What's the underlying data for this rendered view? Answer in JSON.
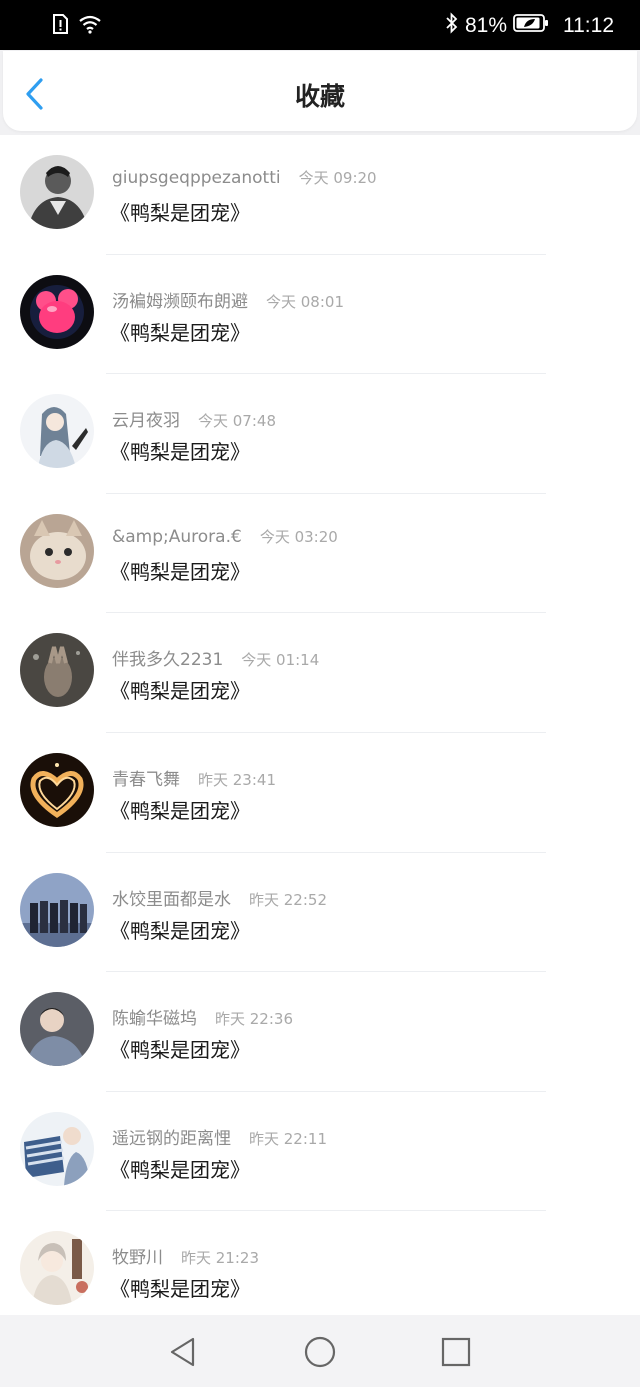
{
  "status_bar": {
    "battery": "81%",
    "time": "11:12",
    "icons": [
      "sim-alert-icon",
      "wifi-icon",
      "bluetooth-icon",
      "battery-icon"
    ]
  },
  "header": {
    "title": "收藏",
    "back_icon": "chevron-left-icon"
  },
  "favorites": [
    {
      "user": "giupsgeqppezanotti",
      "time": "今天 09:20",
      "title": "《鸭梨是团宠》",
      "avatar_color": "#7a7a7a"
    },
    {
      "user": "汤褊姆濒颐布朗避",
      "time": "今天 08:01",
      "title": "《鸭梨是团宠》",
      "avatar_color": "#e2437a"
    },
    {
      "user": "云月夜羽",
      "time": "今天 07:48",
      "title": "《鸭梨是团宠》",
      "avatar_color": "#dfe6ee"
    },
    {
      "user": "&amp;Aurora.€",
      "time": "今天 03:20",
      "title": "《鸭梨是团宠》",
      "avatar_color": "#c9a98d"
    },
    {
      "user": "伴我多久2231",
      "time": "今天 01:14",
      "title": "《鸭梨是团宠》",
      "avatar_color": "#3d3b36"
    },
    {
      "user": "青春飞舞",
      "time": "昨天 23:41",
      "title": "《鸭梨是团宠》",
      "avatar_color": "#2a1a10"
    },
    {
      "user": "水饺里面都是水",
      "time": "昨天 22:52",
      "title": "《鸭梨是团宠》",
      "avatar_color": "#7f93b8"
    },
    {
      "user": "陈蝓华磁坞",
      "time": "昨天 22:36",
      "title": "《鸭梨是团宠》",
      "avatar_color": "#6a6e78"
    },
    {
      "user": "遥远钢的距离悝",
      "time": "昨天 22:11",
      "title": "《鸭梨是团宠》",
      "avatar_color": "#9fb0c8"
    },
    {
      "user": "牧野川",
      "time": "昨天 21:23",
      "title": "《鸭梨是团宠》",
      "avatar_color": "#d7cfc4"
    }
  ],
  "nav_bar": {
    "buttons": [
      "back-triangle-icon",
      "home-circle-icon",
      "recents-square-icon"
    ]
  },
  "colors": {
    "accent": "#2f9ef0",
    "username": "#8c8c8c",
    "timestamp": "#a9a9a9",
    "title": "#1a1a1a"
  }
}
